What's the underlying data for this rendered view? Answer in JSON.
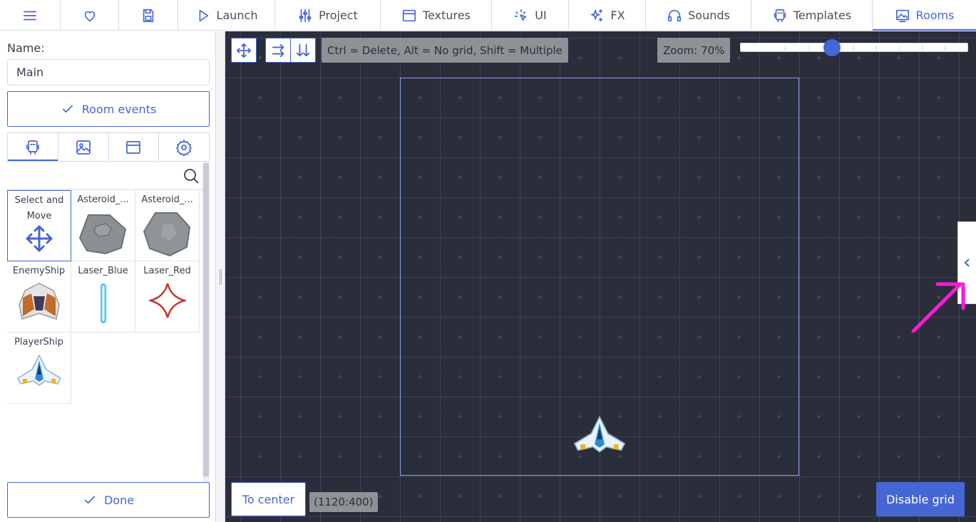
{
  "nav": {
    "tabs": [
      {
        "label": "",
        "icon": "menu-icon"
      },
      {
        "label": "",
        "icon": "heart-icon"
      },
      {
        "label": "",
        "icon": "save-icon"
      },
      {
        "label": "Launch",
        "icon": "play-icon"
      },
      {
        "label": "Project",
        "icon": "sliders-icon"
      },
      {
        "label": "Textures",
        "icon": "image-frame-icon"
      },
      {
        "label": "UI",
        "icon": "cursor-click-icon"
      },
      {
        "label": "FX",
        "icon": "sparkles-icon"
      },
      {
        "label": "Sounds",
        "icon": "headphones-icon"
      },
      {
        "label": "Templates",
        "icon": "template-icon"
      },
      {
        "label": "Rooms",
        "icon": "room-icon"
      }
    ],
    "active": "Rooms"
  },
  "left_panel": {
    "name_label": "Name:",
    "name_value": "Main",
    "room_events_label": "Room events",
    "subtabs": [
      "templates-tab-icon",
      "backgrounds-tab-icon",
      "tiles-tab-icon",
      "settings-tab-icon"
    ],
    "search_placeholder": "",
    "templates": [
      {
        "label": "Select and Move",
        "icon": "move-arrows-icon"
      },
      {
        "label": "Asteroid_...",
        "icon": "asteroid-big-icon"
      },
      {
        "label": "Asteroid_...",
        "icon": "asteroid-medium-icon"
      },
      {
        "label": "EnemyShip",
        "icon": "enemy-ship-icon"
      },
      {
        "label": "Laser_Blue",
        "icon": "laser-blue-icon"
      },
      {
        "label": "Laser_Red",
        "icon": "laser-red-icon"
      },
      {
        "label": "PlayerShip",
        "icon": "player-ship-icon"
      }
    ],
    "done_label": "Done"
  },
  "canvas": {
    "hint": "Ctrl = Delete, Alt = No grid, Shift = Multiple",
    "zoom_label": "Zoom: 70%",
    "zoom_fraction": 0.4,
    "to_center_label": "To center",
    "coordinates": "(1120:400)",
    "disable_grid_label": "Disable grid"
  },
  "colors": {
    "accent": "#4666d6",
    "canvas_bg": "#2a2d3a",
    "annotation": "#ff19d7"
  }
}
